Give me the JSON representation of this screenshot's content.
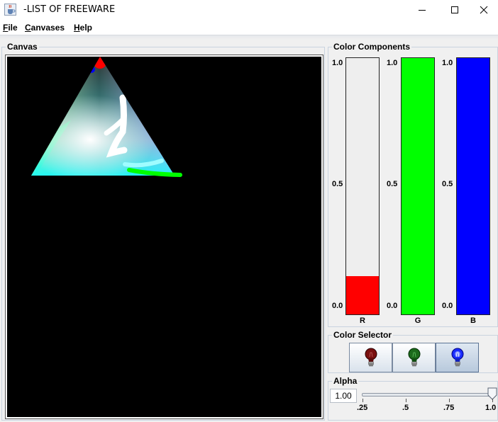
{
  "window": {
    "title": "-LIST OF FREEWARE",
    "app_icon": "java-cup-icon",
    "controls": [
      "minimize-icon",
      "maximize-icon",
      "close-icon"
    ]
  },
  "menu": {
    "items": [
      {
        "mnemonic": "F",
        "rest": "ile"
      },
      {
        "mnemonic": "C",
        "rest": "anvases"
      },
      {
        "mnemonic": "H",
        "rest": "elp"
      }
    ]
  },
  "canvas": {
    "title": "Canvas",
    "background": "#000000"
  },
  "components": {
    "title": "Color Components",
    "axis": {
      "top": "1.0",
      "mid": "0.5",
      "bottom": "0.0"
    },
    "bars": [
      {
        "name": "R",
        "value": 0.15,
        "color": "#ff0000"
      },
      {
        "name": "G",
        "value": 1.0,
        "color": "#00ff00"
      },
      {
        "name": "B",
        "value": 1.0,
        "color": "#0000ff"
      }
    ]
  },
  "selector": {
    "title": "Color Selector",
    "buttons": [
      {
        "icon": "red-bulb-icon",
        "color": "#7a1010",
        "selected": false
      },
      {
        "icon": "green-bulb-icon",
        "color": "#1c6a1c",
        "selected": false
      },
      {
        "icon": "blue-bulb-icon",
        "color": "#1a2cff",
        "selected": true
      }
    ]
  },
  "alpha": {
    "title": "Alpha",
    "value": "1.00",
    "slider_value": 1.0,
    "ticks": [
      ".25",
      ".5",
      ".75",
      "1.0"
    ]
  }
}
